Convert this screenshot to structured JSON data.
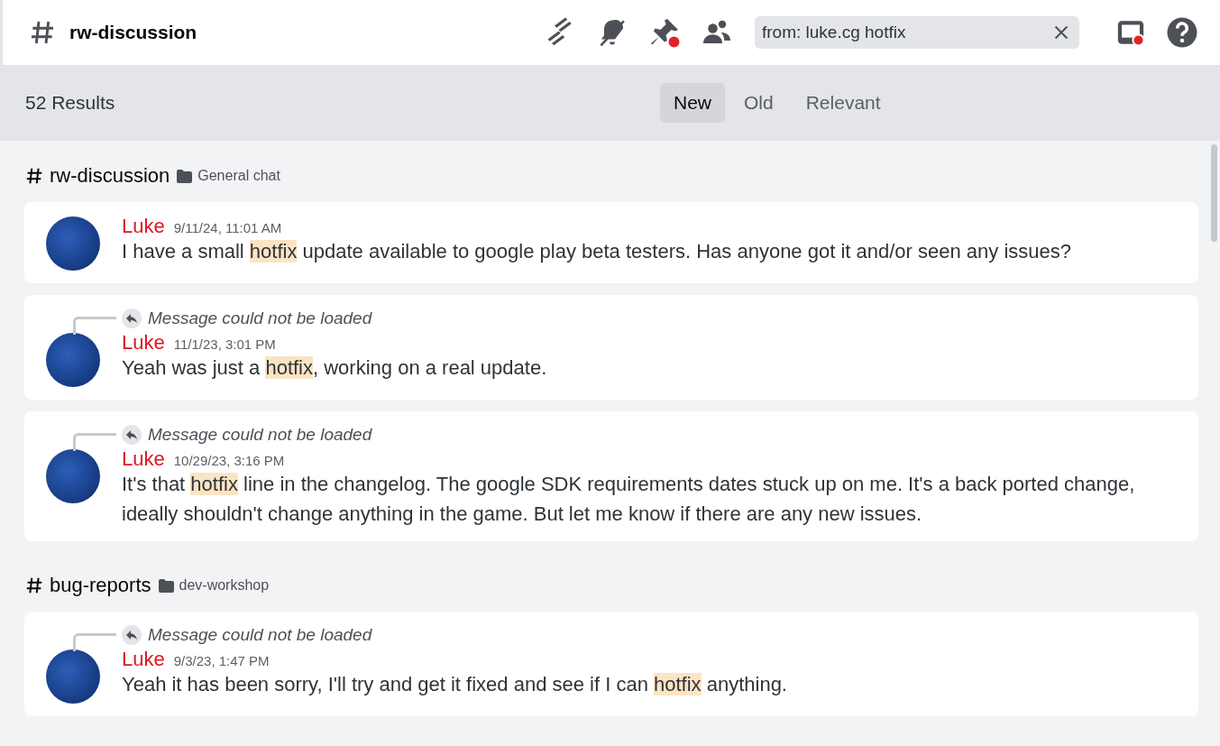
{
  "header": {
    "channel": "rw-discussion",
    "search": {
      "value": "from: luke.cg hotfix"
    }
  },
  "results_bar": {
    "count": "52 Results",
    "sort_tabs": [
      {
        "label": "New",
        "selected": true
      },
      {
        "label": "Old",
        "selected": false
      },
      {
        "label": "Relevant",
        "selected": false
      }
    ]
  },
  "groups": [
    {
      "channel": "rw-discussion",
      "category": "General chat",
      "messages": [
        {
          "author": "Luke",
          "time": "9/11/24, 11:01 AM",
          "parts": [
            {
              "text": "I have a small ",
              "highlight": false
            },
            {
              "text": "hotfix",
              "highlight": true
            },
            {
              "text": " update available to google play beta testers. Has anyone got it and/or seen any issues?",
              "highlight": false
            }
          ]
        },
        {
          "reply": "Message could not be loaded",
          "author": "Luke",
          "time": "11/1/23, 3:01 PM",
          "parts": [
            {
              "text": "Yeah was just a ",
              "highlight": false
            },
            {
              "text": "hotfix",
              "highlight": true
            },
            {
              "text": ", working on a real update.",
              "highlight": false
            }
          ]
        },
        {
          "reply": "Message could not be loaded",
          "author": "Luke",
          "time": "10/29/23, 3:16 PM",
          "parts": [
            {
              "text": "It's that ",
              "highlight": false
            },
            {
              "text": "hotfix",
              "highlight": true
            },
            {
              "text": " line in the changelog. The google SDK requirements dates stuck up on me. It's a back ported change, ideally shouldn't change anything in the game. But let me know if there are any new issues.",
              "highlight": false
            }
          ]
        }
      ]
    },
    {
      "channel": "bug-reports",
      "category": "dev-workshop",
      "messages": [
        {
          "reply": "Message could not be loaded",
          "author": "Luke",
          "time": "9/3/23, 1:47 PM",
          "parts": [
            {
              "text": "Yeah it has been sorry, I'll try and get it fixed and see if I can ",
              "highlight": false
            },
            {
              "text": "hotfix",
              "highlight": true
            },
            {
              "text": " anything.",
              "highlight": false
            }
          ]
        }
      ]
    }
  ]
}
